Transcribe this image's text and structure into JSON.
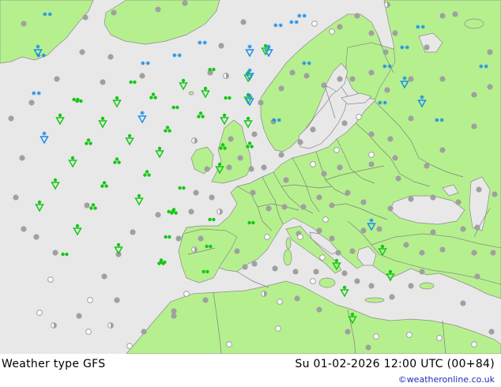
{
  "header": {
    "title": "Weather type",
    "model": "GFS",
    "valid_time": "Su 01-02-2026 12:00 UTC (00+84)",
    "credit": "©weatheronline.co.uk"
  },
  "colors": {
    "sea": "#e8e8e8",
    "land": "#b6f08e",
    "border": "#7f7f7f",
    "rain": "#16c616",
    "snow": "#1c8ee8",
    "cloud": "#a0a0a0"
  },
  "legend_symbols": [
    "rain-shower-symbol",
    "drizzle-symbol",
    "rain-symbol",
    "snow-symbol",
    "overcast-dot",
    "cloudy-dot"
  ]
}
